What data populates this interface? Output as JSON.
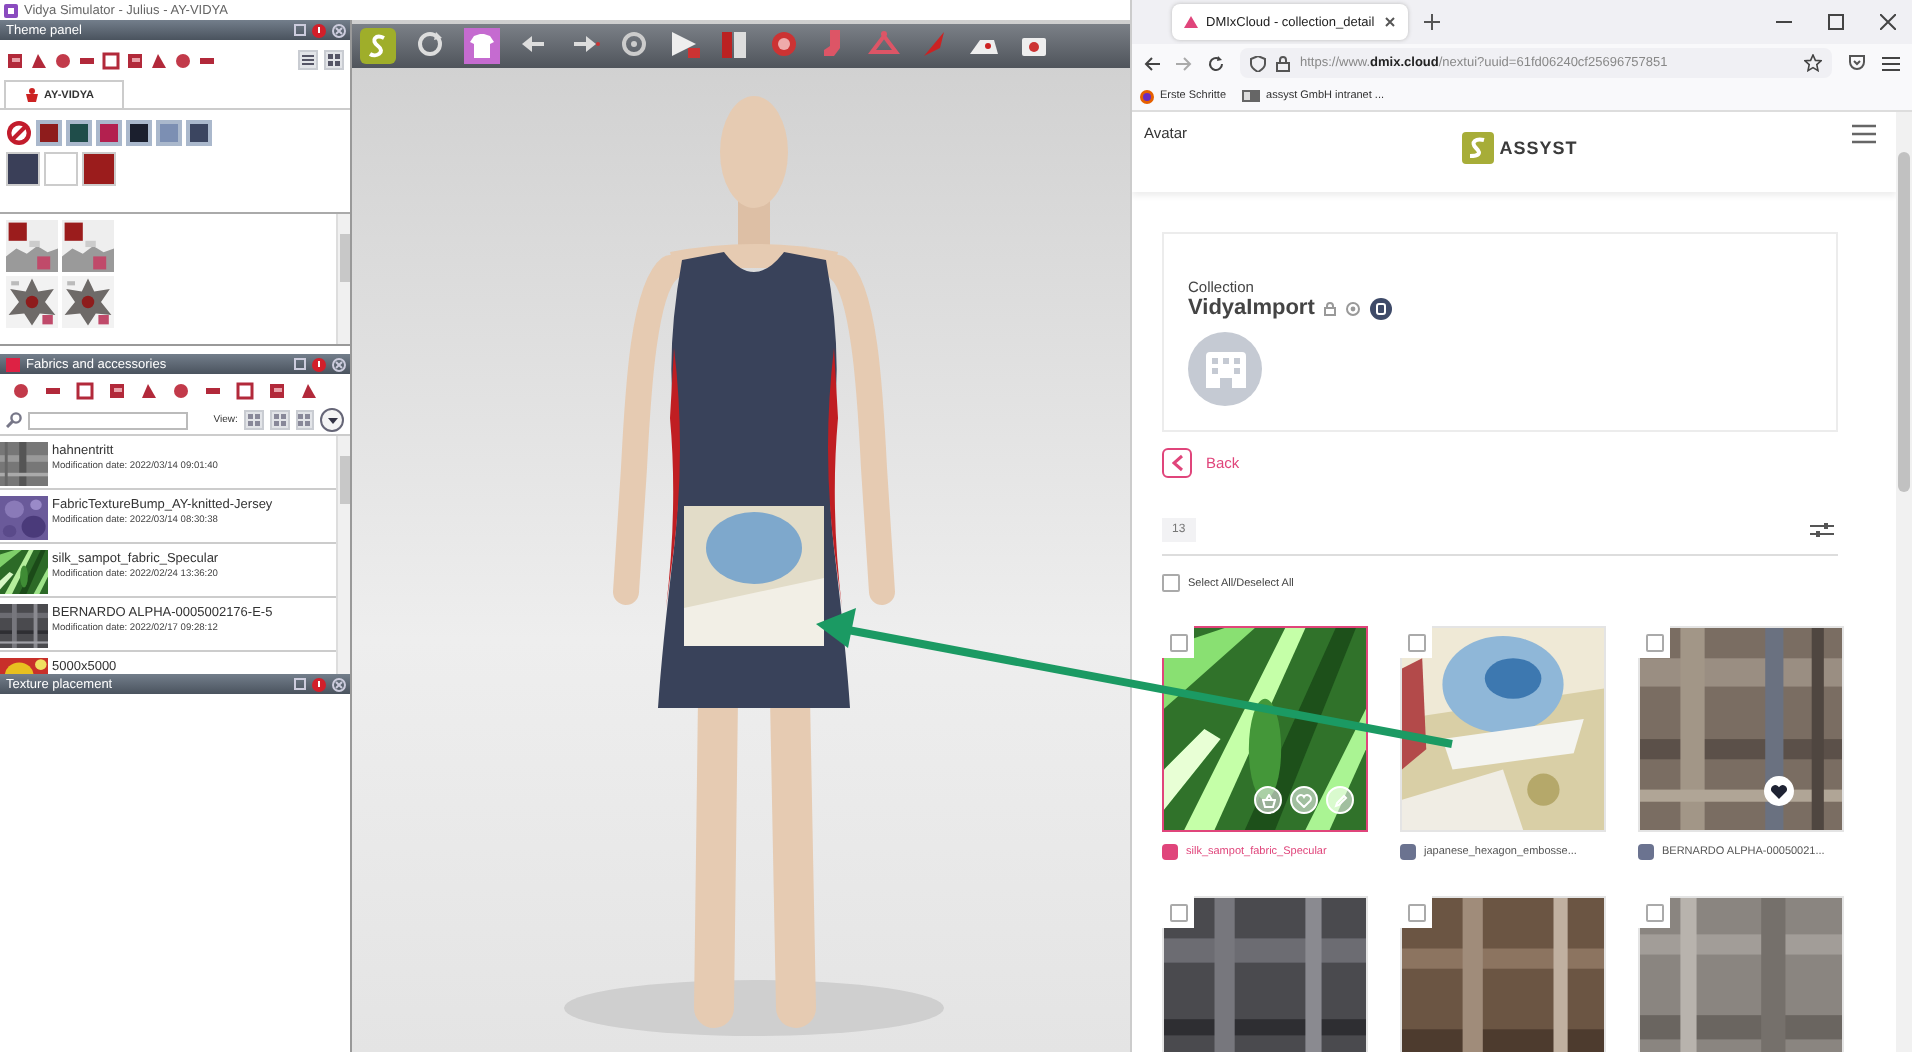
{
  "app": {
    "title": "Vidya Simulator - Julius - AY-VIDYA"
  },
  "theme_panel": {
    "title": "Theme panel",
    "tabs": [
      {
        "label": "AY-VIDYA",
        "selected": true
      }
    ],
    "swatches": [
      {
        "color": "#8e1c1c"
      },
      {
        "color": "#1f4d4a"
      },
      {
        "color": "#b3204f"
      },
      {
        "color": "#1b1f2e"
      },
      {
        "color": "#7c8fb3"
      },
      {
        "color": "#3b4560"
      }
    ],
    "color_blocks": [
      {
        "color": "#3a3f58"
      },
      {
        "color": "#ffffff"
      },
      {
        "color": "#9b1c1c"
      }
    ]
  },
  "fabrics_panel": {
    "title": "Fabrics and accessories",
    "view_label": "View:",
    "items": [
      {
        "name": "hahnentritt",
        "date": "Modification date: 2022/03/14 09:01:40"
      },
      {
        "name": "FabricTextureBump_AY-knitted-Jersey",
        "date": "Modification date: 2022/03/14 08:30:38"
      },
      {
        "name": "silk_sampot_fabric_Specular",
        "date": "Modification date: 2022/02/24 13:36:20"
      },
      {
        "name": "BERNARDO ALPHA-0005002176-E-5",
        "date": "Modification date: 2022/02/17 09:28:12"
      },
      {
        "name": "5000x5000"
      }
    ]
  },
  "texture_panel": {
    "title": "Texture placement"
  },
  "browser": {
    "tabs": [
      {
        "title": "DMIxCloud - collection_detail",
        "selected": true
      }
    ],
    "url": "https://www.**dmix.cloud**/nextui?uuid=61fd06240cf25696757851",
    "bookmarks": [
      {
        "label": "Erste Schritte"
      },
      {
        "label": "assyst GmbH intranet ..."
      }
    ]
  },
  "page": {
    "header_title": "Avatar",
    "logo": "ASSYST",
    "collection": {
      "label": "Collection",
      "name": "VidyaImport"
    },
    "back": "Back",
    "count": "13",
    "select_all": {
      "label": "Select All/Deselect All",
      "checked": false
    },
    "cards": [
      {
        "label": "silk_sampot_fabric_Specular",
        "selected": true,
        "checked": false,
        "hovered": true,
        "favorite": false
      },
      {
        "label": "japanese_hexagon_embosse...",
        "selected": false,
        "checked": false,
        "hovered": false,
        "favorite": false
      },
      {
        "label": "BERNARDO ALPHA-00050021...",
        "selected": false,
        "checked": false,
        "hovered": false,
        "favorite": true
      },
      {
        "selected": false,
        "checked": false,
        "hovered": false,
        "favorite": false
      },
      {
        "selected": false,
        "checked": false,
        "hovered": false,
        "favorite": false
      },
      {
        "selected": false,
        "checked": false,
        "hovered": false,
        "favorite": false
      }
    ]
  }
}
